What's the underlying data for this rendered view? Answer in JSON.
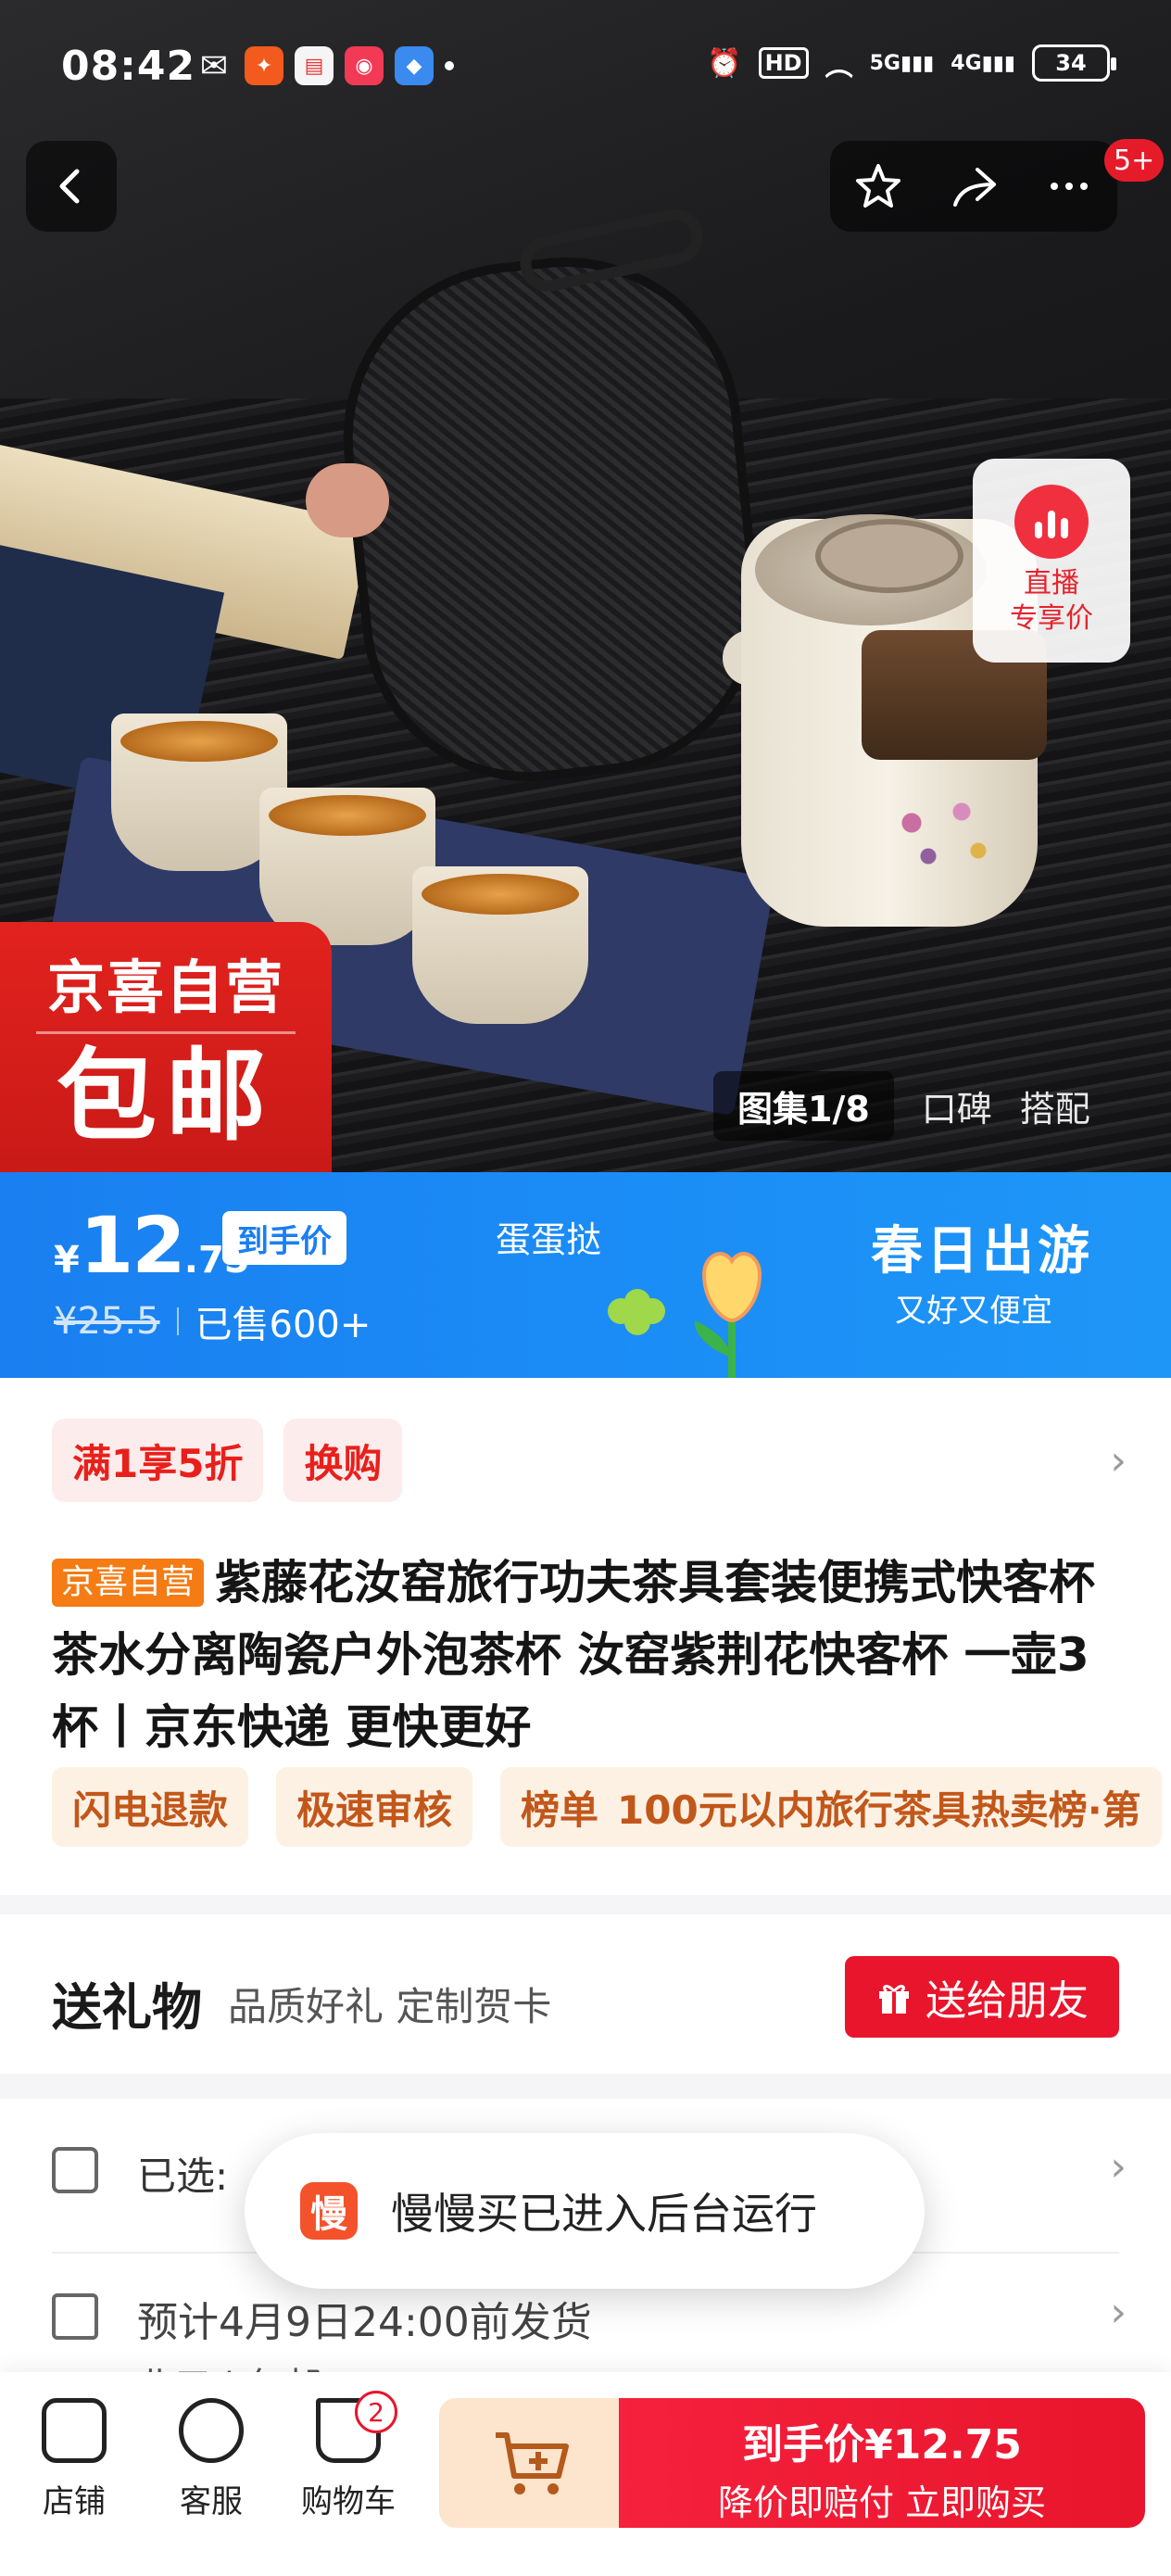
{
  "status_bar": {
    "time": "08:42",
    "hd": "HD",
    "net1": "5G",
    "net2": "4G",
    "battery": "34"
  },
  "nav": {
    "back_icon": "chevron-left",
    "star_icon": "star-outline",
    "share_icon": "share-arrow",
    "more_icon": "more-dots",
    "more_badge": "5+"
  },
  "live": {
    "label": "直播\n专享价",
    "line1": "直播",
    "line2": "专享价"
  },
  "stamp": {
    "line1": "京喜自营",
    "line2": "包邮"
  },
  "gallery": {
    "active": "图集1/8",
    "tab1": "口碑",
    "tab2": "搭配"
  },
  "price": {
    "yen": "¥",
    "integer": "12",
    "decimal": ".75",
    "tag": "到手价",
    "original": "¥25.5",
    "sold": "已售600+",
    "egg_label": "蛋蛋挞",
    "banner_title": "春日出游",
    "banner_sub": "又好又便宜"
  },
  "promos": [
    "满1享5折",
    "换购"
  ],
  "product": {
    "badge": "京喜自营",
    "title": "紫藤花汝窑旅行功夫茶具套装便携式快客杯茶水分离陶瓷户外泡茶杯 汝窑紫荆花快客杯 一壶3杯丨京东快递 更快更好"
  },
  "tags": {
    "t1": "闪电退款",
    "t2": "极速审核",
    "t3_key": "榜单",
    "t3_val": "100元以内旅行茶具热卖榜·第"
  },
  "gift": {
    "title": "送礼物",
    "sub": "品质好礼 定制贺卡",
    "button": "送给朋友"
  },
  "selection": {
    "selected": "已选:",
    "ship": "预计4月9日24:00前发货",
    "origin": "北口 | 包邮"
  },
  "toast": {
    "icon_char": "慢",
    "text": "慢慢买已进入后台运行"
  },
  "bottom_bar": {
    "store": "店铺",
    "service": "客服",
    "cart": "购物车",
    "cart_count": "2",
    "buy_top": "到手价¥12.75",
    "buy_bottom": "降价即赔付 立即购买"
  },
  "colors": {
    "accent_red": "#e8152c",
    "banner_blue": "#1a7ff0",
    "tag_orange": "#f57b14"
  }
}
